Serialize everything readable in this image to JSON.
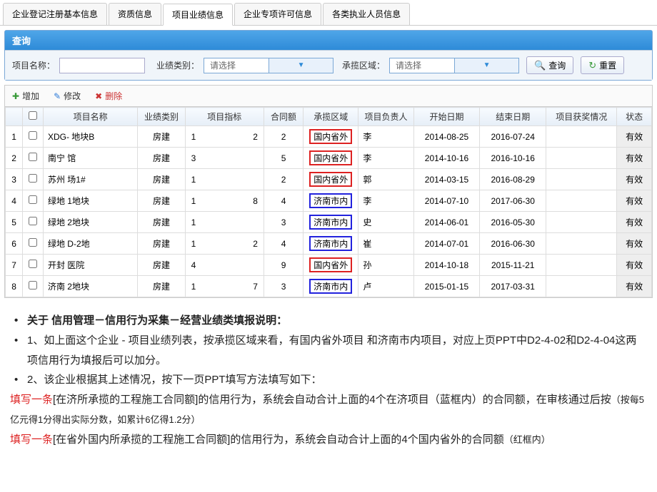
{
  "tabs": [
    "企业登记注册基本信息",
    "资质信息",
    "项目业绩信息",
    "企业专项许可信息",
    "各类执业人员信息"
  ],
  "active_tab": 2,
  "query": {
    "panel_title": "查询",
    "name_label": "项目名称：",
    "type_label": "业绩类别：",
    "type_placeholder": "请选择",
    "region_label": "承揽区域：",
    "region_placeholder": "请选择",
    "search_btn": "查询",
    "reset_btn": "重置"
  },
  "toolbar": {
    "add": "增加",
    "edit": "修改",
    "del": "删除"
  },
  "columns": [
    "",
    "",
    "项目名称",
    "业绩类别",
    "项目指标",
    "合同额",
    "承揽区域",
    "项目负责人",
    "开始日期",
    "结束日期",
    "项目获奖情况",
    "状态"
  ],
  "rows": [
    {
      "n": "1",
      "name": "XDG-        地块B",
      "cat": "房建",
      "idx1": "1",
      "idx2": "2",
      "amt": "2",
      "region": "国内省外",
      "box": "red",
      "mgr": "李",
      "start": "2014-08-25",
      "end": "2016-07-24",
      "award": "",
      "st": "有效"
    },
    {
      "n": "2",
      "name": "南宁          馆",
      "cat": "房建",
      "idx1": "3",
      "idx2": "",
      "amt": "5",
      "region": "国内省外",
      "box": "red",
      "mgr": "李",
      "start": "2014-10-16",
      "end": "2016-10-16",
      "award": "",
      "st": "有效"
    },
    {
      "n": "3",
      "name": "苏州         场1#",
      "cat": "房建",
      "idx1": "1",
      "idx2": "",
      "amt": "2",
      "region": "国内省外",
      "box": "red",
      "mgr": "郭",
      "start": "2014-03-15",
      "end": "2016-08-29",
      "award": "",
      "st": "有效"
    },
    {
      "n": "4",
      "name": "绿地        1地块",
      "cat": "房建",
      "idx1": "1",
      "idx2": "8",
      "amt": "4",
      "region": "济南市内",
      "box": "blue",
      "mgr": "李",
      "start": "2014-07-10",
      "end": "2017-06-30",
      "award": "",
      "st": "有效"
    },
    {
      "n": "5",
      "name": "绿地        2地块",
      "cat": "房建",
      "idx1": "1",
      "idx2": "",
      "amt": "3",
      "region": "济南市内",
      "box": "blue",
      "mgr": "史",
      "start": "2014-06-01",
      "end": "2016-05-30",
      "award": "",
      "st": "有效"
    },
    {
      "n": "6",
      "name": "绿地       D-2地",
      "cat": "房建",
      "idx1": "1",
      "idx2": "2",
      "amt": "4",
      "region": "济南市内",
      "box": "blue",
      "mgr": "崔",
      "start": "2014-07-01",
      "end": "2016-06-30",
      "award": "",
      "st": "有效"
    },
    {
      "n": "7",
      "name": "开封         医院",
      "cat": "房建",
      "idx1": "4",
      "idx2": "",
      "amt": "9",
      "region": "国内省外",
      "box": "red",
      "mgr": "孙",
      "start": "2014-10-18",
      "end": "2015-11-21",
      "award": "",
      "st": "有效"
    },
    {
      "n": "8",
      "name": "济南       2地块",
      "cat": "房建",
      "idx1": "1",
      "idx2": "7",
      "amt": "3",
      "region": "济南市内",
      "box": "blue",
      "mgr": "卢",
      "start": "2015-01-15",
      "end": "2017-03-31",
      "award": "",
      "st": "有效"
    }
  ],
  "notes": {
    "l1": "关于 信用管理－信用行为采集－经营业绩类填报说明：",
    "l2": "1、如上面这个企业 - 项目业绩列表，按承揽区域来看，有国内省外项目 和济南市内项目，对应上页PPT中D2-4-02和D2-4-04这两项信用行为填报后可以加分。",
    "l3": "2、该企业根据其上述情况，按下一页PPT填写方法填写如下：",
    "l4a": "填写一条",
    "l4b": "[在济所承揽的工程施工合同额]的信用行为，系统会自动合计上面的4个在济项目（蓝框内）的合同额，在审核通过后按",
    "l4c": "（按每5亿元得1分得出实际分数，如累计6亿得1.2分）",
    "l5a": "填写一条",
    "l5b": "[在省外国内所承揽的工程施工合同额]的信用行为，系统会自动合计上面的4个国内省外的合同额",
    "l5c": "（红框内）"
  }
}
